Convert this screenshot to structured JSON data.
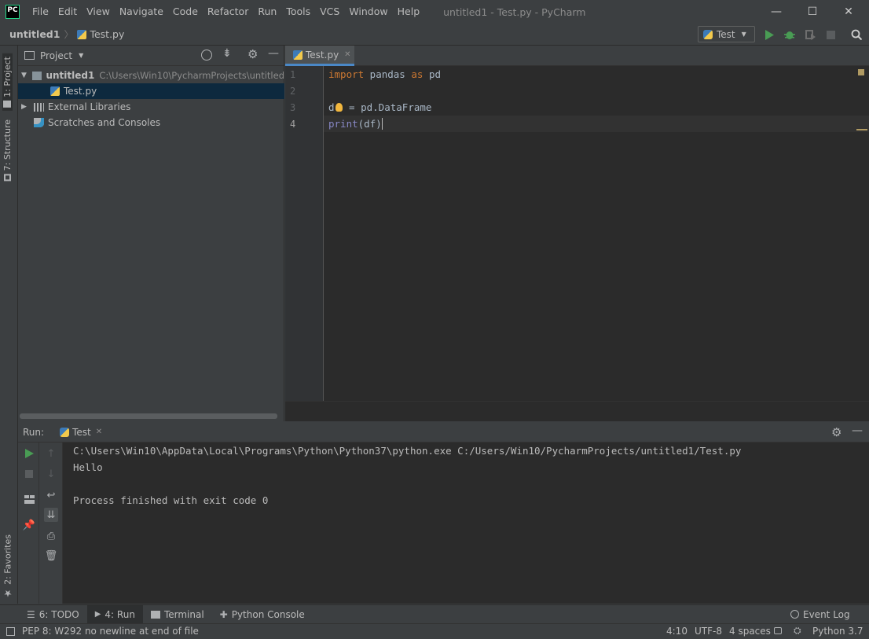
{
  "app": {
    "title": "untitled1 - Test.py - PyCharm",
    "logo": "PC"
  },
  "menu": [
    {
      "label": "File"
    },
    {
      "label": "Edit"
    },
    {
      "label": "View"
    },
    {
      "label": "Navigate"
    },
    {
      "label": "Code"
    },
    {
      "label": "Refactor"
    },
    {
      "label": "Run"
    },
    {
      "label": "Tools"
    },
    {
      "label": "VCS"
    },
    {
      "label": "Window"
    },
    {
      "label": "Help"
    }
  ],
  "window_controls": {
    "minimize": "—",
    "maximize": "☐",
    "close": "✕"
  },
  "breadcrumb": {
    "project": "untitled1",
    "file": "Test.py"
  },
  "run_config": {
    "label": "Test"
  },
  "sidebar_left": {
    "project_tab": "1: Project",
    "structure_tab": "7: Structure",
    "favorites_tab": "2: Favorites"
  },
  "project_panel": {
    "title": "Project",
    "tree": {
      "root": {
        "label": "untitled1",
        "path": "C:\\Users\\Win10\\PycharmProjects\\untitled"
      },
      "file": {
        "label": "Test.py"
      },
      "external": {
        "label": "External Libraries"
      },
      "scratches": {
        "label": "Scratches and Consoles"
      }
    }
  },
  "editor": {
    "tab_label": "Test.py",
    "line_numbers": [
      "1",
      "2",
      "3",
      "4"
    ],
    "code": {
      "l1_kw": "import",
      "l1_mod": " pandas ",
      "l1_as": "as",
      "l1_alias": " pd",
      "l3_var_a": "d",
      "l3_rest": " = pd.DataFrame",
      "l4_fn": "print",
      "l4_args": "(df)"
    }
  },
  "run_panel": {
    "label": "Run:",
    "tab": "Test",
    "console": [
      "C:\\Users\\Win10\\AppData\\Local\\Programs\\Python\\Python37\\python.exe C:/Users/Win10/PycharmProjects/untitled1/Test.py",
      "Hello",
      "",
      "Process finished with exit code 0"
    ]
  },
  "bottom_tabs": [
    {
      "label": "6: TODO"
    },
    {
      "label": "4: Run"
    },
    {
      "label": "Terminal"
    },
    {
      "label": "Python Console"
    }
  ],
  "event_log": "Event Log",
  "status": {
    "message": "PEP 8: W292 no newline at end of file",
    "position": "4:10",
    "encoding": "UTF-8",
    "indent": "4 spaces",
    "interpreter": "Python 3.7"
  },
  "colors": {
    "accent": "#4a88c7",
    "run_green": "#499c54",
    "keyword": "#cc7832",
    "builtin": "#8888c6"
  }
}
